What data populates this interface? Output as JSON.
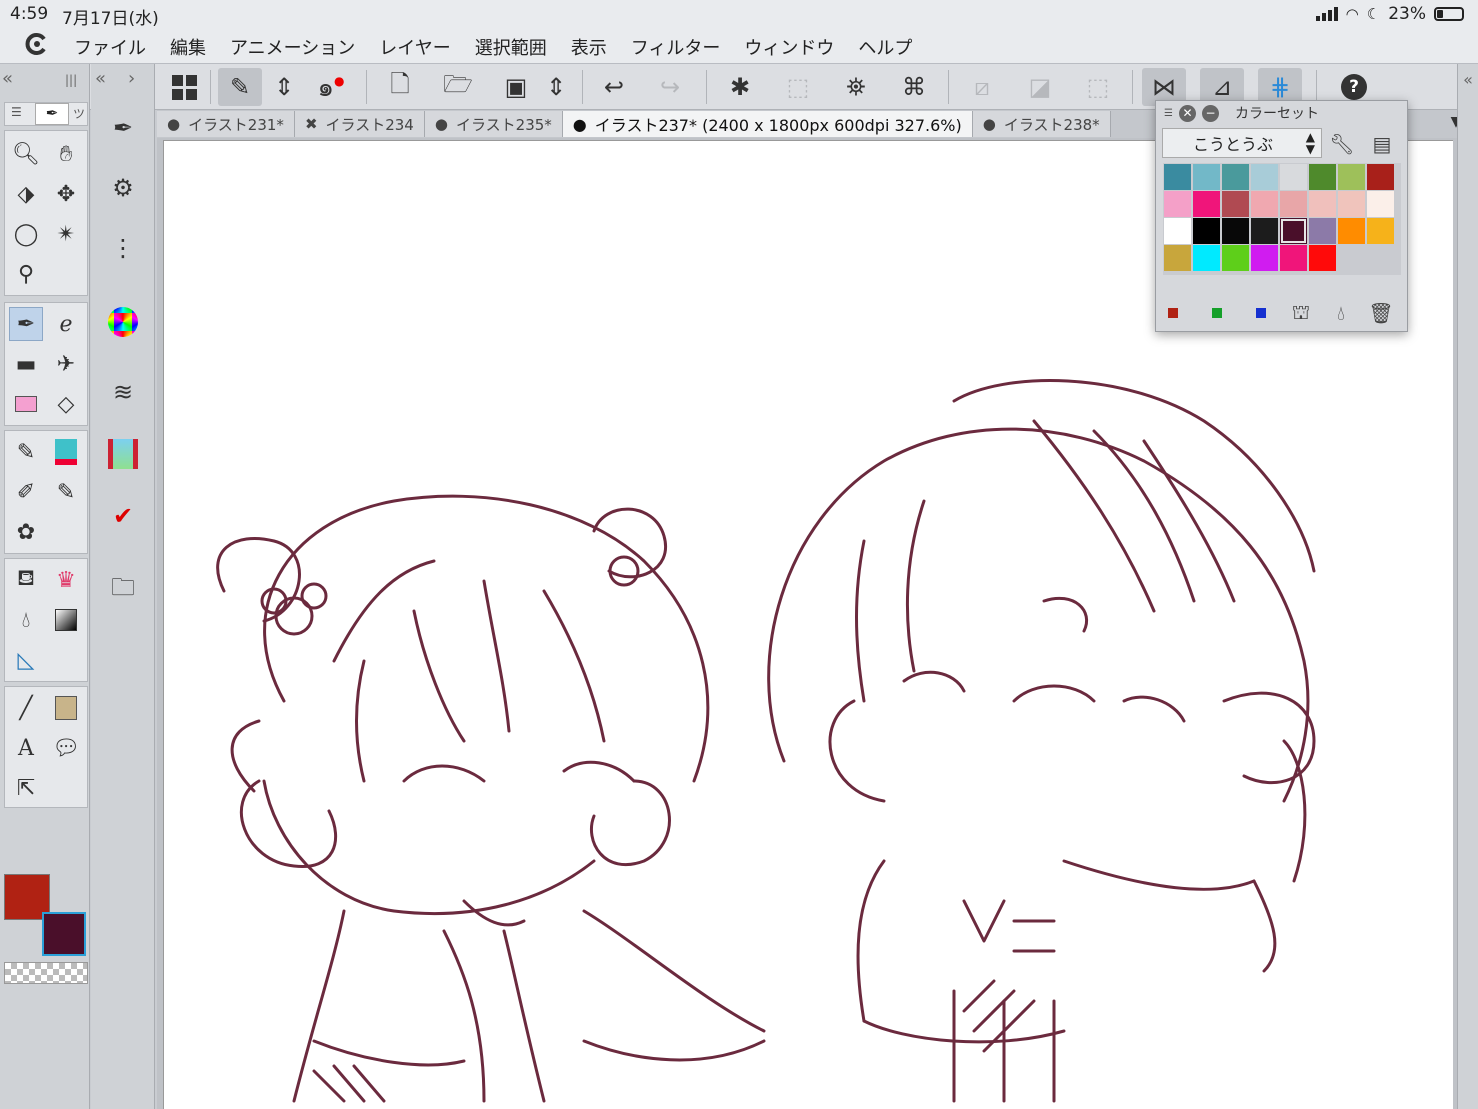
{
  "status_bar": {
    "time": "4:59",
    "date": "7月17日(水)",
    "battery": "23%"
  },
  "menu": {
    "items": [
      "ファイル",
      "編集",
      "アニメーション",
      "レイヤー",
      "選択範囲",
      "表示",
      "フィルター",
      "ウィンドウ",
      "ヘルプ"
    ]
  },
  "toolbar": {
    "help": "?"
  },
  "tabs": [
    {
      "label": "イラスト231*",
      "marker": "●"
    },
    {
      "label": "イラスト234",
      "marker": "✖"
    },
    {
      "label": "イラスト235*",
      "marker": "●"
    },
    {
      "label": "イラスト237* (2400 x 1800px 600dpi 327.6%)",
      "marker": "●"
    },
    {
      "label": "イラスト238*",
      "marker": "●"
    }
  ],
  "color_set": {
    "title": "カラーセット",
    "set_name": "こうとうぶ",
    "swatches": [
      "#3a8ba0",
      "#72b8c8",
      "#4a9a9c",
      "#a8ccd8",
      "#d8dadd",
      "#4f8a2c",
      "#9ec05a",
      "#a8201a",
      "#f4a0c8",
      "#f0157a",
      "#b04a52",
      "#f0a8b0",
      "#e8a6a8",
      "#f0c0bc",
      "#f0c4bc",
      "#fbefe9",
      "#ffffff",
      "#000000",
      "#080808",
      "#1c1c1c",
      "#4a0f2a",
      "#8c7aa8",
      "#ff8c00",
      "#f6b21a",
      "#c8a63c",
      "#00eaff",
      "#5ecf1a",
      "#d01cf0",
      "#f0157a",
      "#ff0a0a"
    ],
    "current_index": 20
  },
  "colors": {
    "main": "#b02213",
    "sub": "#4a0f2a",
    "line": "#6b2a3e"
  }
}
